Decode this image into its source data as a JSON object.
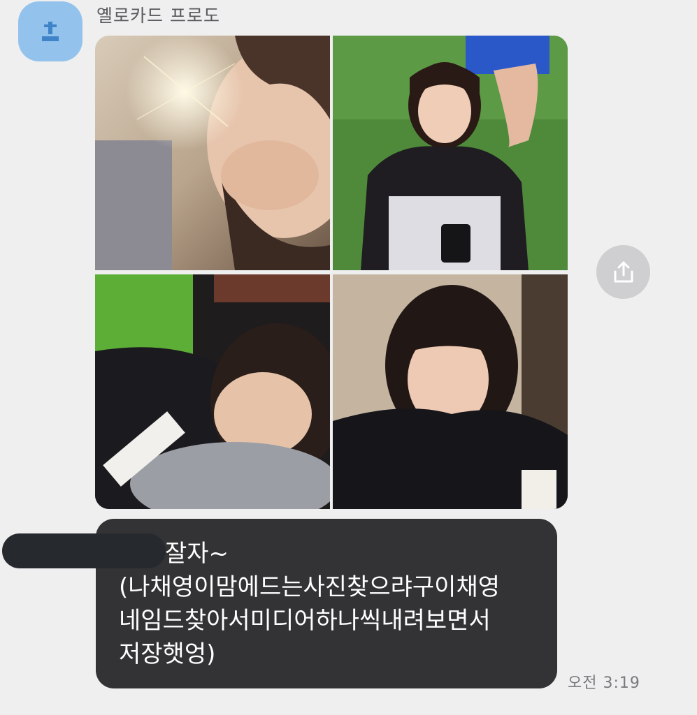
{
  "chat": {
    "sender_name": "옐로카드 프로도",
    "sender_avatar_icon": "profile-icon",
    "avatar_color": "#93c3ec",
    "photo_message": {
      "photo_count": 4,
      "photos": [
        {
          "name": "photo-1",
          "description_icon": "photo"
        },
        {
          "name": "photo-2",
          "description_icon": "photo"
        },
        {
          "name": "photo-3",
          "description_icon": "photo"
        },
        {
          "name": "photo-4",
          "description_icon": "photo"
        }
      ]
    },
    "share_icon": "share-icon",
    "text_message": {
      "line1": "잘자~",
      "line2": "(나채영이맘에드는사진찾으랴구이채영",
      "line3": "네임드찾아서미디어하나씩내려보면서",
      "line4": "저장햇엉)"
    },
    "timestamp": "오전 3:19",
    "bubble_color": "#333336"
  }
}
